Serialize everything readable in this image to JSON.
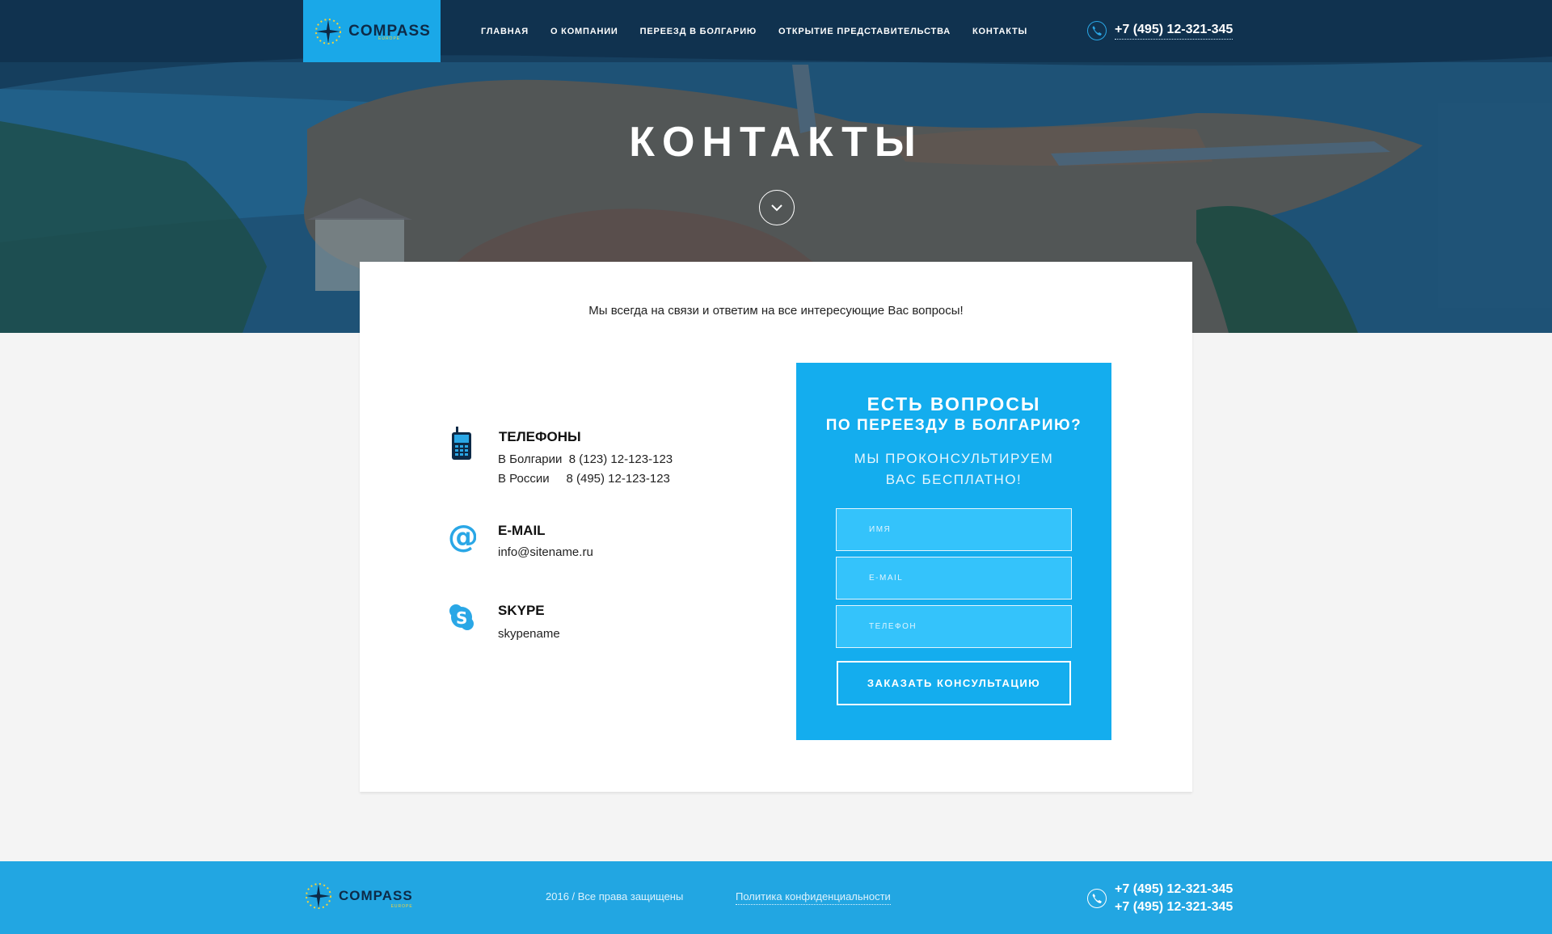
{
  "header": {
    "logo_text": "COMPASS",
    "logo_sub": "EUROPE",
    "nav": [
      {
        "label": "ГЛАВНАЯ"
      },
      {
        "label": "О КОМПАНИИ"
      },
      {
        "label": "ПЕРЕЕЗД В БОЛГАРИЮ"
      },
      {
        "label": "ОТКРЫТИЕ ПРЕДСТАВИТЕЛЬСТВА"
      },
      {
        "label": "КОНТАКТЫ"
      }
    ],
    "phone": "+7 (495) 12-321-345"
  },
  "hero": {
    "title": "КОНТАКТЫ"
  },
  "main": {
    "intro": "Мы всегда на связи и ответим на все интересующие Вас вопросы!",
    "phones": {
      "heading": "ТЕЛЕФОНЫ",
      "bulgaria_label": "В Болгарии",
      "bulgaria_number": "8 (123) 12-123-123",
      "russia_label": "В России",
      "russia_number": "8 (495) 12-123-123"
    },
    "email": {
      "heading": "E-MAIL",
      "value": "info@sitename.ru"
    },
    "skype": {
      "heading": "SKYPE",
      "value": "skypename"
    }
  },
  "form": {
    "title_line1": "ЕСТЬ ВОПРОСЫ",
    "title_line2": "ПО ПЕРЕЕЗДУ В БОЛГАРИЮ?",
    "subtitle_line1": "МЫ ПРОКОНСУЛЬТИРУЕМ",
    "subtitle_line2": "ВАС БЕСПЛАТНО!",
    "name_placeholder": "ИМЯ",
    "email_placeholder": "E-MAIL",
    "phone_placeholder": "ТЕЛЕФОН",
    "submit_label": "ЗАКАЗАТЬ КОНСУЛЬТАЦИЮ"
  },
  "footer": {
    "logo_text": "COMPASS",
    "logo_sub": "EUROPE",
    "copyright": "2016 / Все права защищены",
    "policy": "Политика конфиденциальности",
    "phone1": "+7 (495) 12-321-345",
    "phone2": "+7 (495) 12-321-345"
  },
  "colors": {
    "accent": "#1aa8e8",
    "form_bg": "#14adee",
    "footer_bg": "#22a6e2",
    "logo_text": "#0d2a47"
  },
  "icons": [
    "compass-logo-icon",
    "phone-icon",
    "chevron-down-icon",
    "mobile-phone-icon",
    "at-sign-icon",
    "skype-icon"
  ]
}
